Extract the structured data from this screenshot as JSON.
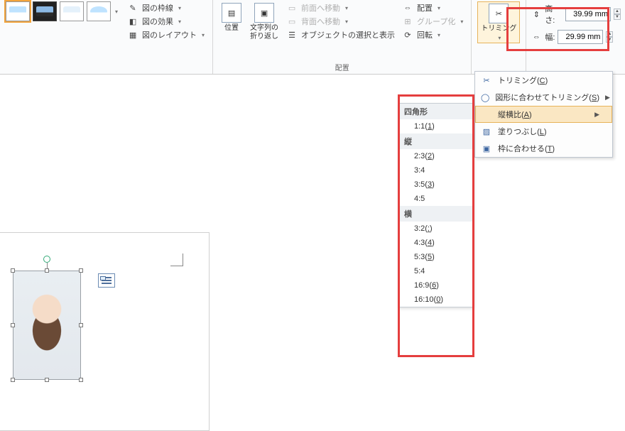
{
  "ribbon": {
    "pic_border": "図の枠線",
    "pic_effects": "図の効果",
    "pic_layout": "図のレイアウト",
    "position": "位置",
    "wrap_text_l1": "文字列の",
    "wrap_text_l2": "折り返し",
    "bring_forward": "前面へ移動",
    "send_backward": "背面へ移動",
    "selection_pane": "オブジェクトの選択と表示",
    "align": "配置",
    "group": "グループ化",
    "rotate": "回転",
    "arrange_group_label": "配置",
    "trim": "トリミング"
  },
  "size": {
    "height_label": "高さ:",
    "height_value": "39.99 mm",
    "width_label": "幅:",
    "width_value": "29.99 mm"
  },
  "trim_menu": {
    "trimming": "トリミング(",
    "trimming_k": "C",
    "fit_shape": "図形に合わせてトリミング(",
    "fit_shape_k": "S",
    "aspect": "縦横比(",
    "aspect_k": "A",
    "fill": "塗りつぶし(",
    "fill_k": "L",
    "fit": "枠に合わせる(",
    "fit_k": "T",
    "close": ")"
  },
  "ratio": {
    "square_h": "四角形",
    "r1": "1:1(",
    "r1k": "1",
    "portrait_h": "縦",
    "r2": "2:3(",
    "r2k": "2",
    "r3": "3:4",
    "r4": "3:5(",
    "r4k": "3",
    "r5": "4:5",
    "landscape_h": "横",
    "r6": "3:2(",
    "r6k": ":",
    "r7": "4:3(",
    "r7k": "4",
    "r8": "5:3(",
    "r8k": "5",
    "r9": "5:4",
    "r10": "16:9(",
    "r10k": "6",
    "r11": "16:10(",
    "r11k": "0"
  }
}
